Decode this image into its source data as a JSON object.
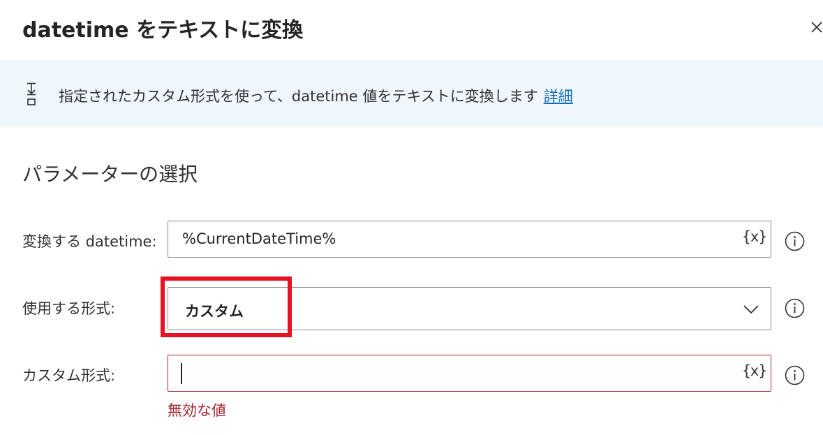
{
  "dialog": {
    "title": "datetime をテキストに変換"
  },
  "banner": {
    "description": "指定されたカスタム形式を使って、datetime 値をテキストに変換します",
    "link_label": "詳細"
  },
  "section": {
    "title": "パラメーターの選択"
  },
  "params": {
    "datetime_label": "変換する datetime:",
    "datetime_value": "%CurrentDateTime%",
    "datetime_var_button": "{x}",
    "format_label": "使用する形式:",
    "format_value": "カスタム",
    "custom_label": "カスタム形式:",
    "custom_value": "",
    "custom_var_button": "{x}",
    "custom_error": "無効な値"
  },
  "colors": {
    "banner_bg": "#eff6fc",
    "link": "#0f6cbd",
    "error": "#a4262c",
    "highlight": "#e81123"
  }
}
